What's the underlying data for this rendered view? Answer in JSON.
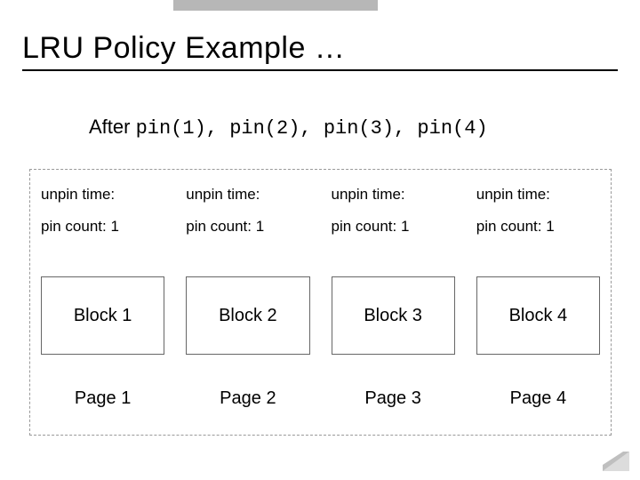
{
  "title": "LRU Policy Example …",
  "subtitle_prefix": "After ",
  "subtitle_code": "pin(1), pin(2), pin(3), pin(4)",
  "labels": {
    "unpin": "unpin time:",
    "pincount_prefix": "pin count: "
  },
  "columns": [
    {
      "pin_count": 1,
      "block": "Block 1",
      "page": "Page 1"
    },
    {
      "pin_count": 1,
      "block": "Block 2",
      "page": "Page 2"
    },
    {
      "pin_count": 1,
      "block": "Block 3",
      "page": "Page 3"
    },
    {
      "pin_count": 1,
      "block": "Block 4",
      "page": "Page 4"
    }
  ]
}
